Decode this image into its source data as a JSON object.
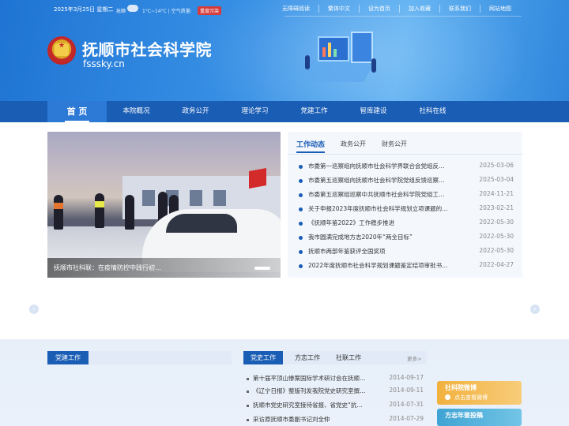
{
  "topbar": {
    "date": "2025年3月25日 星期二",
    "city": "抚顺",
    "temp": "1°C~14°C | 空气质量:",
    "air_quality": "重度污染",
    "links": [
      "无障碍阅读",
      "繁体中文",
      "设为首页",
      "加入收藏",
      "联系我们",
      "网站地图"
    ]
  },
  "site": {
    "title": "抚顺市社会科学院",
    "domain": "fsssky.cn"
  },
  "nav": {
    "items": [
      "首 页",
      "本院概况",
      "政务公开",
      "理论学习",
      "党建工作",
      "智库建设",
      "社科在线"
    ],
    "active_index": 0
  },
  "slider": {
    "caption": "抚顺市社科联：在疫情防控中践行初…"
  },
  "news": {
    "tabs": [
      "工作动态",
      "政务公开",
      "财务公开"
    ],
    "active_tab": 0,
    "items": [
      {
        "title": "市委第一巡察组向抚顺市社会科学界联合会党组反…",
        "date": "2025-03-06"
      },
      {
        "title": "市委第五巡察组向抚顺市社会科学院党组反馈巡察…",
        "date": "2025-03-04"
      },
      {
        "title": "市委第五巡察组巡察中共抚顺市社会科学院党组工…",
        "date": "2024-11-21"
      },
      {
        "title": "关于申报2023年度抚顺市社会科学规划立项课题的…",
        "date": "2023-02-21"
      },
      {
        "title": "《抚顺年鉴2022》工作稳步推进",
        "date": "2022-05-30"
      },
      {
        "title": "我市圆满完成地方志2020年“两全目标”",
        "date": "2022-05-30"
      },
      {
        "title": "抚顺市两部年鉴获评全国奖项",
        "date": "2022-05-30"
      },
      {
        "title": "2022年度抚顺市社会科学规划课题鉴定结项审批书…",
        "date": "2022-04-27"
      }
    ]
  },
  "arrows": {
    "prev": "‹",
    "next": "›"
  },
  "bottom": {
    "left_section": "党建工作",
    "tabs": [
      "党史工作",
      "方志工作",
      "社联工作"
    ],
    "active_tab": 0,
    "more": "更多>",
    "items": [
      {
        "title": "第十届平顶山惨案国际学术研讨会在抚顺…",
        "date": "2014-09-17"
      },
      {
        "title": "《辽宁日报》整版刊发我院党史研究室撰…",
        "date": "2014-09-11"
      },
      {
        "title": "抚顺市党史研究室接待省报、省党史“抗…",
        "date": "2014-07-31"
      },
      {
        "title": "采访原抚顺市委副书记刘全仲",
        "date": "2014-07-29"
      }
    ],
    "cards": [
      {
        "title": "社科院微博",
        "sub": "点击查看微博",
        "color": "#f0b84a"
      },
      {
        "title": "方志年鉴投稿",
        "sub": "",
        "color": "#4fb0d6"
      }
    ]
  },
  "colors": {
    "brand": "#1a5db5",
    "accent": "#2c79d6",
    "alert": "#d63a3a"
  }
}
